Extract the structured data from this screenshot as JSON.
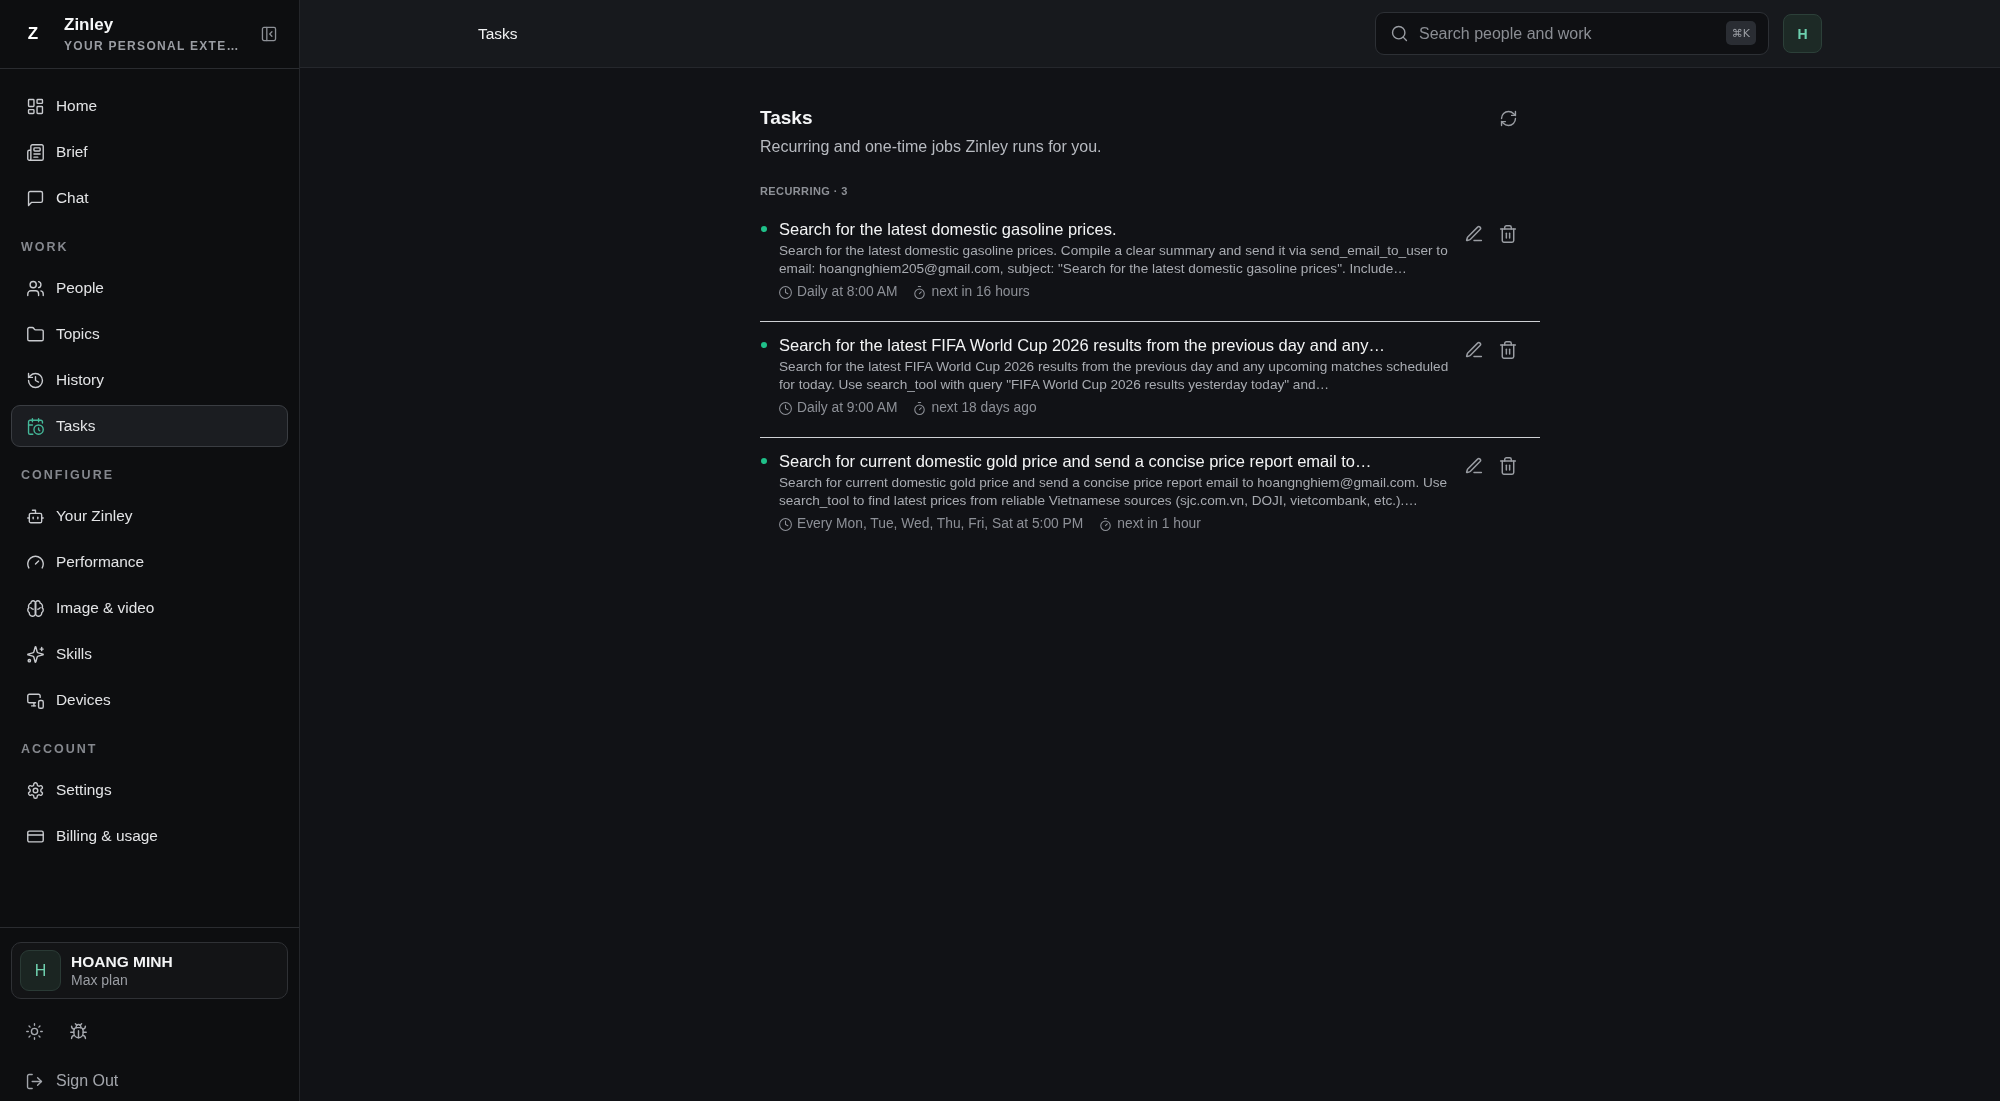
{
  "sidebar": {
    "brand": {
      "logo": "Z",
      "name": "Zinley",
      "tagline": "YOUR PERSONAL EXTE…"
    },
    "sections": [
      {
        "items": [
          {
            "label": "Home",
            "selected": false
          },
          {
            "label": "Brief",
            "selected": false
          },
          {
            "label": "Chat",
            "selected": false
          }
        ]
      },
      {
        "title": "WORK",
        "items": [
          {
            "label": "People",
            "selected": false
          },
          {
            "label": "Topics",
            "selected": false
          },
          {
            "label": "History",
            "selected": false
          },
          {
            "label": "Tasks",
            "selected": true
          }
        ]
      },
      {
        "title": "CONFIGURE",
        "items": [
          {
            "label": "Your Zinley",
            "selected": false
          },
          {
            "label": "Performance",
            "selected": false
          },
          {
            "label": "Image & video",
            "selected": false
          },
          {
            "label": "Skills",
            "selected": false
          },
          {
            "label": "Devices",
            "selected": false
          }
        ]
      },
      {
        "title": "ACCOUNT",
        "items": [
          {
            "label": "Settings",
            "selected": false
          },
          {
            "label": "Billing & usage",
            "selected": false
          }
        ]
      }
    ],
    "user": {
      "initial": "H",
      "name": "HOANG MINH",
      "plan": "Max plan"
    },
    "sign_out": "Sign Out"
  },
  "topbar": {
    "title": "Tasks",
    "search": {
      "placeholder": "Search people and work",
      "shortcut": "⌘K"
    },
    "avatar": "H"
  },
  "page": {
    "title": "Tasks",
    "subtitle": "Recurring and one-time jobs Zinley runs for you.",
    "groups": [
      {
        "label": "RECURRING · 3",
        "tasks": [
          {
            "active": true,
            "title": "Search for the latest domestic gasoline prices.",
            "description": "Search for the latest domestic gasoline prices. Compile a clear summary and send it via send_email_to_user to email: hoangnghiem205@gmail.com, subject: \"Search for the latest domestic gasoline prices\". Include…",
            "schedule": "Daily at 8:00 AM",
            "next_run": "next in 16 hours"
          },
          {
            "active": true,
            "title": "Search for the latest FIFA World Cup 2026 results from the previous day and any…",
            "description": "Search for the latest FIFA World Cup 2026 results from the previous day and any upcoming matches scheduled for today. Use search_tool with query \"FIFA World Cup 2026 results yesterday today\" and…",
            "schedule": "Daily at 9:00 AM",
            "next_run": "next 18 days ago"
          },
          {
            "active": true,
            "title": "Search for current domestic gold price and send a concise price report email to…",
            "description": "Search for current domestic gold price and send a concise price report email to hoangnghiem@gmail.com. Use search_tool to find latest prices from reliable Vietnamese sources (sjc.com.vn, DOJI, vietcombank, etc.).…",
            "schedule": "Every Mon, Tue, Wed, Thu, Fri, Sat at 5:00 PM",
            "next_run": "next in 1 hour"
          }
        ]
      }
    ]
  }
}
